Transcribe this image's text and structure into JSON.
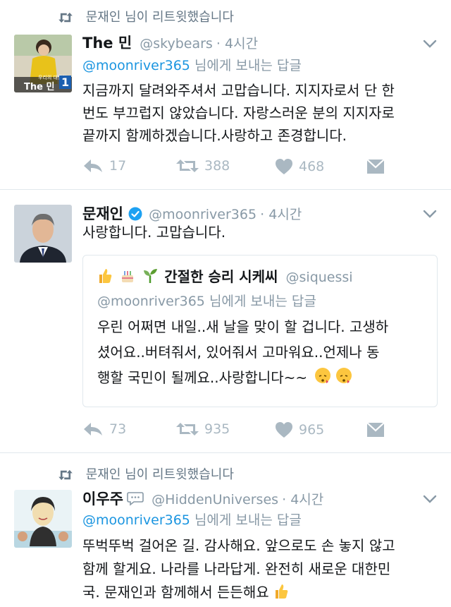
{
  "tweet1": {
    "retweet_note": "문재인 님이 리트윗했습니다",
    "name": "The 민",
    "handle": "@skybears",
    "time": "· 4시간",
    "reply_to_handle": "@moonriver365",
    "reply_to_suffix": " 님에게 보내는 답글",
    "avatar_caption": "The 민",
    "avatar_badge": "1",
    "avatar_small_text": "우리의 대통령",
    "lines": [
      "지금까지 달려와주셔서 고맙습니다. 지지자로서 단 한",
      "번도 부끄럽지 않았습니다. 자랑스러운 분의 지지자로",
      "끝까지 함께하겠습니다.사랑하고 존경합니다."
    ],
    "replies": "17",
    "retweets": "388",
    "likes": "468"
  },
  "tweet2": {
    "name": "문재인",
    "handle": "@moonriver365",
    "time": "· 4시간",
    "text": "사랑합니다. 고맙습니다.",
    "quote": {
      "name": "간절한 승리 시케씨",
      "handle": "@siquessi",
      "reply_to_handle": "@moonriver365",
      "reply_to_suffix": " 님에게 보내는 답글",
      "lines": [
        "우린 어쩌면 내일..새 날을 맞이 할 겁니다. 고생하",
        "셨어요..버텨줘서, 있어줘서 고마워요..언제나 동",
        "행할 국민이 될께요..사랑합니다~~"
      ]
    },
    "replies": "73",
    "retweets": "935",
    "likes": "965"
  },
  "tweet3": {
    "retweet_note": "문재인 님이 리트윗했습니다",
    "name": "이우주",
    "handle": "@HiddenUniverses",
    "time": "· 4시간",
    "reply_to_handle": "@moonriver365",
    "reply_to_suffix": " 님에게 보내는 답글",
    "lines": [
      "뚜벅뚜벅 걸어온 길. 감사해요. 앞으로도 손 놓지 않고",
      "함께 할게요. 나라를 나라답게. 완전히 새로운 대한민",
      "국. 문재인과 함께해서 든든해요"
    ]
  },
  "colors": {
    "link": "#1b95e0",
    "muted": "#8899a6",
    "icon": "#aab8c2",
    "verified": "#1da1f2"
  }
}
